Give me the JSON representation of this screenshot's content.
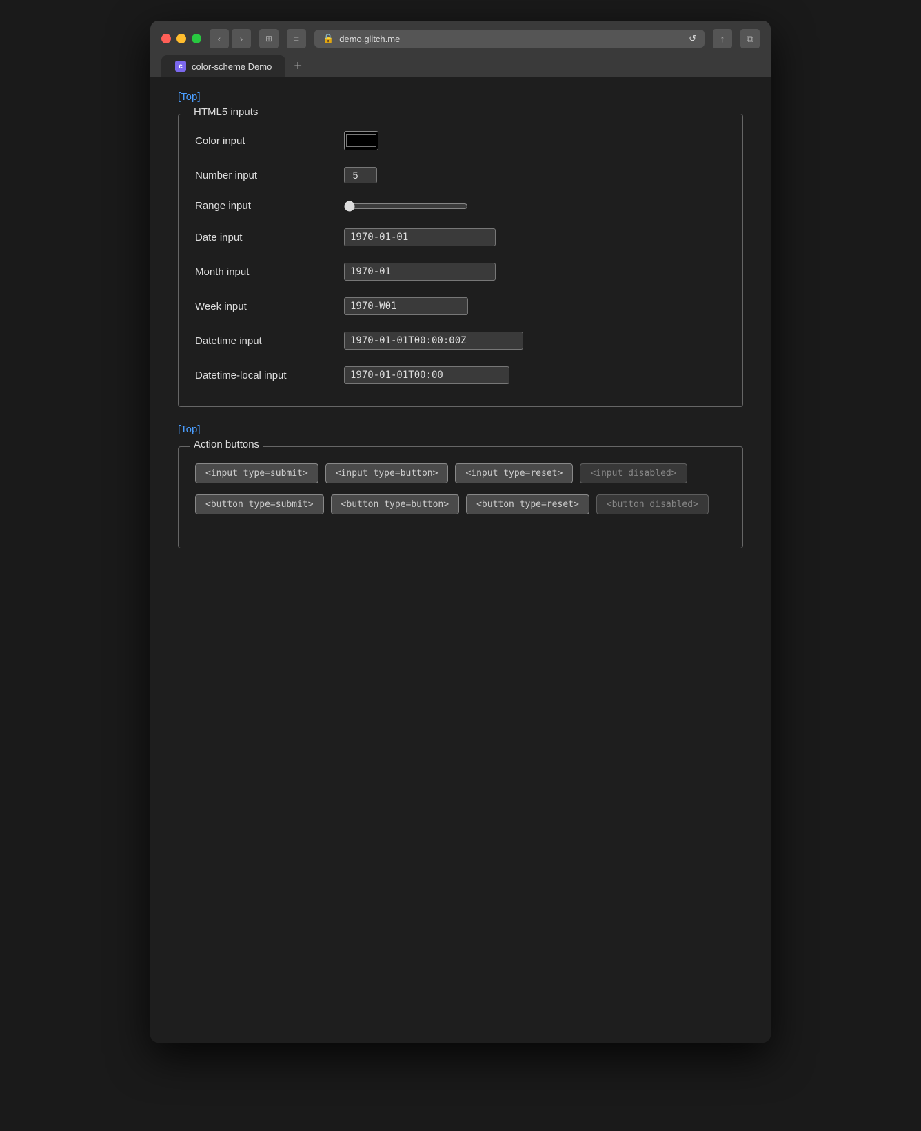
{
  "browser": {
    "url": "demo.glitch.me",
    "tab_title": "color-scheme Demo",
    "tab_icon_letter": "c"
  },
  "nav": {
    "back_label": "‹",
    "forward_label": "›",
    "sidebar_label": "⊞",
    "menu_label": "≡",
    "reload_label": "↺",
    "share_label": "↑",
    "tabs_label": "⧉",
    "tab_plus": "+"
  },
  "page": {
    "top_link": "[Top]",
    "sections": [
      {
        "id": "html5-inputs",
        "legend": "HTML5 inputs",
        "inputs": [
          {
            "label": "Color input",
            "type": "color",
            "value": "#000000"
          },
          {
            "label": "Number input",
            "type": "number",
            "value": "5"
          },
          {
            "label": "Range input",
            "type": "range",
            "value": "0"
          },
          {
            "label": "Date input",
            "type": "date",
            "value": "1970-01-01"
          },
          {
            "label": "Month input",
            "type": "month",
            "value": "1970-01"
          },
          {
            "label": "Week input",
            "type": "week",
            "value": "1970-W01"
          },
          {
            "label": "Datetime input",
            "type": "datetime",
            "value": "1970-01-01T00:00:00Z"
          },
          {
            "label": "Datetime-local input",
            "type": "datetime-local",
            "value": "1970-01-01T00:00"
          }
        ]
      }
    ],
    "top_link2": "[Top]",
    "action_section": {
      "legend": "Action buttons",
      "input_buttons": [
        {
          "label": "<input type=submit>",
          "disabled": false
        },
        {
          "label": "<input type=button>",
          "disabled": false
        },
        {
          "label": "<input type=reset>",
          "disabled": false
        },
        {
          "label": "<input disabled>",
          "disabled": true
        }
      ],
      "button_buttons": [
        {
          "label": "<button type=submit>",
          "disabled": false
        },
        {
          "label": "<button type=button>",
          "disabled": false
        },
        {
          "label": "<button type=reset>",
          "disabled": false
        },
        {
          "label": "<button disabled>",
          "disabled": true
        }
      ]
    }
  }
}
